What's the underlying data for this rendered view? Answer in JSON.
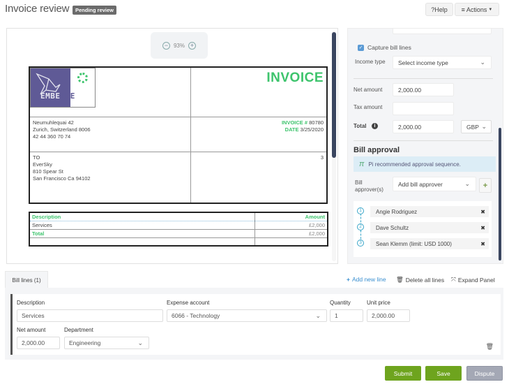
{
  "header": {
    "title": "Invoice review",
    "status_badge": "Pending review",
    "help_label": "Help",
    "help_icon": "?",
    "actions_label": "Actions",
    "actions_icon": "≡"
  },
  "viewer": {
    "zoom_level": "93%",
    "zoom_out_icon": "−",
    "zoom_in_icon": "+"
  },
  "invoice_doc": {
    "heading": "INVOICE",
    "logo_text_a": "EMBE",
    "logo_text_b": "LLE",
    "sender": {
      "line1": "Neumuhlequai 42",
      "line2": "Zurich, Switzerland 8006",
      "line3": "42 44 360 70 74"
    },
    "invoice_no_label": "INVOICE #",
    "invoice_no": "80780",
    "date_label": "DATE",
    "date": "3/25/2020",
    "to": {
      "label": "TO",
      "line1": "EverSky",
      "line2": "810 Spear St",
      "line3": "San Francisco Ca 94102"
    },
    "page_marker": "3",
    "table": {
      "header_desc": "Description",
      "header_amount": "Amount",
      "rows": [
        {
          "desc": "Services",
          "amount": "£2,000"
        }
      ],
      "total_label": "Total",
      "total_amount": "£2,000"
    }
  },
  "right_panel": {
    "top_field_value": "",
    "capture_bill_lines_label": "Capture bill lines",
    "capture_bill_lines_checked": true,
    "income_type_label": "Income type",
    "income_type_placeholder": "Select income type",
    "net_amount_label": "Net amount",
    "net_amount_value": "2,000.00",
    "tax_amount_label": "Tax amount",
    "tax_amount_value": "",
    "total_label": "Total",
    "total_value": "2,000.00",
    "currency": "GBP",
    "bill_approval_title": "Bill approval",
    "banner_text": "Pi recommended approval sequence.",
    "bill_approvers_label": "Bill approver(s)",
    "add_approver_placeholder": "Add bill approver",
    "approvers": [
      {
        "step": "1",
        "name": "Angie Rodriguez"
      },
      {
        "step": "2",
        "name": "Dave Schultz"
      },
      {
        "step": "3",
        "name": "Sean Klemm (limit: USD 1000)"
      }
    ]
  },
  "bill_lines": {
    "tab_label": "Bill lines (1)",
    "add_new_line": "Add new line",
    "delete_all_lines": "Delete all lines",
    "expand_panel": "Expand Panel",
    "line": {
      "description_label": "Description",
      "description_value": "Services",
      "expense_account_label": "Expense account",
      "expense_account_value": "6066 - Technology",
      "quantity_label": "Quantity",
      "quantity_value": "1",
      "unit_price_label": "Unit price",
      "unit_price_value": "2,000.00",
      "net_amount_label": "Net amount",
      "net_amount_value": "2,000.00",
      "department_label": "Department",
      "department_value": "Engineering"
    }
  },
  "footer": {
    "submit_label": "Submit",
    "save_label": "Save",
    "dispute_label": "Dispute"
  },
  "colors": {
    "brand_green": "#3ec46d",
    "button_green": "#6ea41e",
    "link_blue": "#3a8fd0",
    "logo_purple": "#5f5a96",
    "scroll_thumb": "#3b4660"
  }
}
